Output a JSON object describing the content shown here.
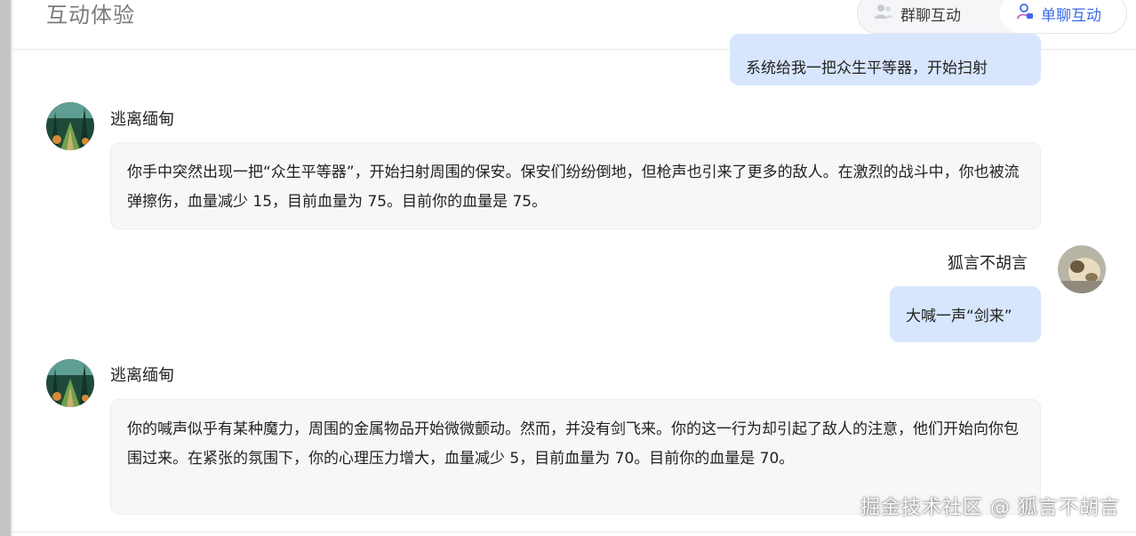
{
  "header": {
    "title": "互动体验",
    "modes": [
      {
        "label": "群聊互动",
        "icon": "users-icon",
        "active": false
      },
      {
        "label": "单聊互动",
        "icon": "user-chat-icon",
        "active": true
      }
    ]
  },
  "colors": {
    "accent": "#3b6be6",
    "user_bubble": "#d8e6fd",
    "bot_bubble": "#f6f7f9"
  },
  "messages": [
    {
      "role": "user",
      "text": "系统给我一把众生平等器，开始扫射"
    },
    {
      "role": "bot",
      "name": "逃离缅甸",
      "text": "你手中突然出现一把“众生平等器”，开始扫射周围的保安。保安们纷纷倒地，但枪声也引来了更多的敌人。在激烈的战斗中，你也被流弹擦伤，血量减少 15，目前血量为 75。目前你的血量是 75。"
    },
    {
      "role": "user",
      "name": "狐言不胡言",
      "text": "大喊一声“剑来”"
    },
    {
      "role": "bot",
      "name": "逃离缅甸",
      "text": "你的喊声似乎有某种魔力，周围的金属物品开始微微颤动。然而，并没有剑飞来。你的这一行为却引起了敌人的注意，他们开始向你包围过来。在紧张的氛围下，你的心理压力增大，血量减少 5，目前血量为 70。目前你的血量是 70。"
    }
  ],
  "watermark": "掘金技术社区 @ 狐言不胡言"
}
